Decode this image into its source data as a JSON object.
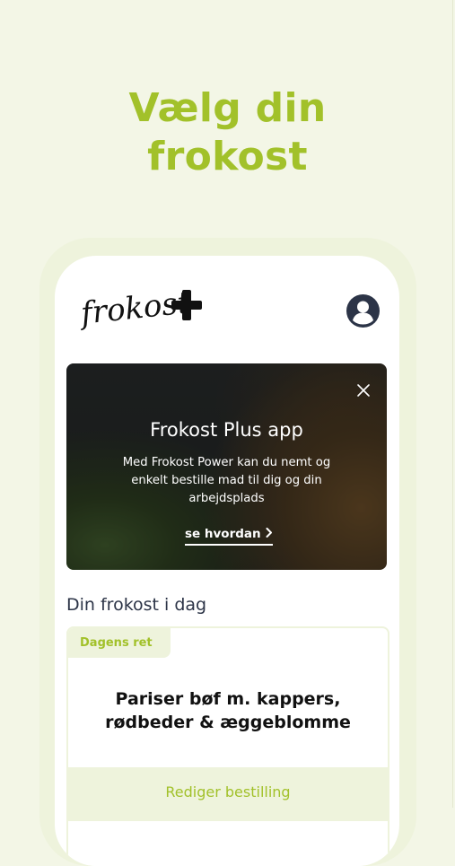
{
  "headline": {
    "line1": "Vælg din",
    "line2": "frokost"
  },
  "app": {
    "logo_text": "frokost",
    "icons": {
      "logo": "plus-icon",
      "profile": "user-icon",
      "close": "close-icon",
      "link": "chevron-right-icon"
    }
  },
  "banner": {
    "title": "Frokost Plus app",
    "text": "Med Frokost Power kan du nemt og enkelt bestille mad til dig og din arbejdsplads",
    "link_label": "se hvordan"
  },
  "today": {
    "section_title": "Din frokost i dag",
    "tag": "Dagens ret",
    "dish": "Pariser bøf m. kappers, rødbeder & æggeblomme",
    "action_label": "Rediger bestilling"
  },
  "colors": {
    "accent": "#a2c12a",
    "background": "#f3f6e6",
    "dark": "#2c3447",
    "tint": "#eef3dc"
  }
}
